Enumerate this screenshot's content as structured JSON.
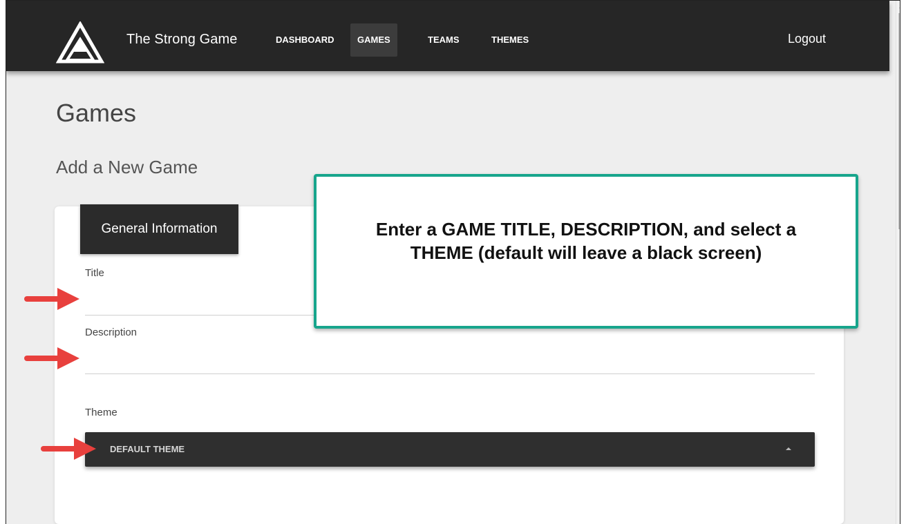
{
  "navbar": {
    "brand": "The Strong Game",
    "items": [
      {
        "label": "DASHBOARD",
        "active": false
      },
      {
        "label": "GAMES",
        "active": true
      },
      {
        "label": "TEAMS",
        "active": false
      },
      {
        "label": "THEMES",
        "active": false
      }
    ],
    "logout": "Logout"
  },
  "page": {
    "title": "Games",
    "section_title": "Add a New Game"
  },
  "form": {
    "tab": "General Information",
    "title_label": "Title",
    "title_value": "",
    "description_label": "Description",
    "description_value": "",
    "theme_label": "Theme",
    "theme_value": "DEFAULT THEME"
  },
  "callout": {
    "text": "Enter a GAME TITLE, DESCRIPTION, and select a THEME (default will leave a black screen)"
  },
  "colors": {
    "navbar": "#262626",
    "callout_border": "#17a58c",
    "arrow": "#e8403d"
  },
  "icons": [
    "logo-mountain-icon",
    "arrow-right-icon",
    "caret-up-icon"
  ]
}
